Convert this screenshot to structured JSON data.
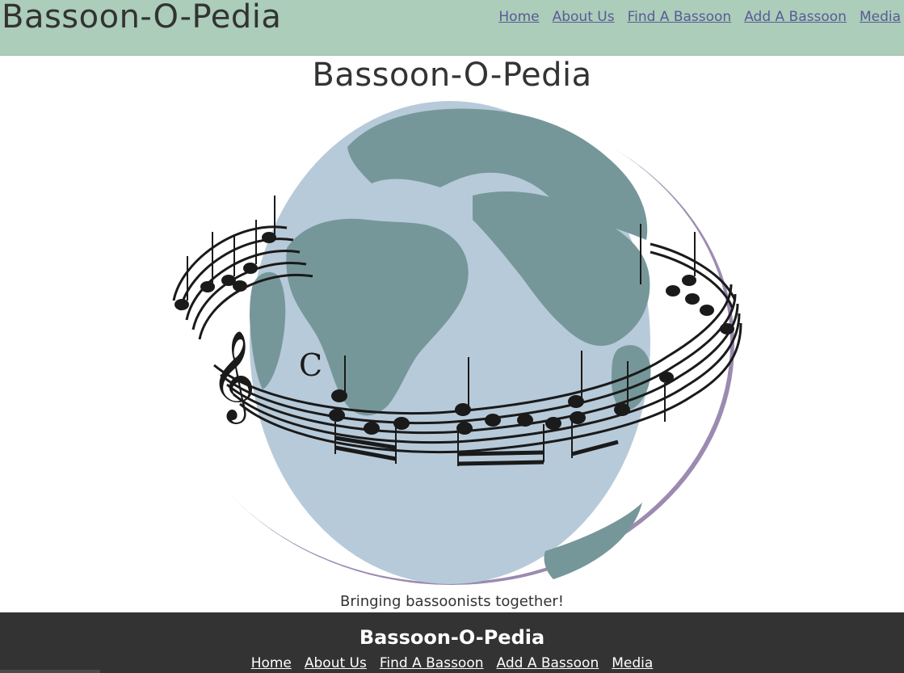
{
  "header": {
    "brand": "Bassoon-O-Pedia",
    "nav": [
      "Home",
      "About Us",
      "Find A Bassoon",
      "Add A Bassoon",
      "Media"
    ]
  },
  "main": {
    "title": "Bassoon-O-Pedia",
    "logo_icon": "globe-with-music-staff-icon",
    "tagline": "Bringing bassoonists together!"
  },
  "footer": {
    "brand": "Bassoon-O-Pedia",
    "nav": [
      "Home",
      "About Us",
      "Find A Bassoon",
      "Add A Bassoon",
      "Media"
    ]
  },
  "colors": {
    "header_bg": "#abcdb9",
    "footer_bg": "#333333",
    "link": "#5a5a96",
    "globe_ocean": "#b7cad9",
    "globe_land": "#76979a",
    "globe_shadow": "#9b8bb0"
  }
}
